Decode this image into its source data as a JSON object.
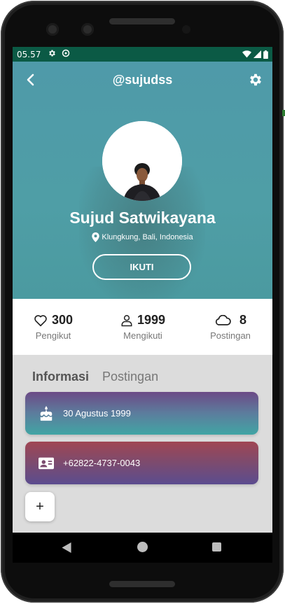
{
  "status_bar": {
    "time": "05.57"
  },
  "header": {
    "username": "@sujudss"
  },
  "profile": {
    "name": "Sujud Satwikayana",
    "location": "Klungkung, Bali, Indonesia",
    "follow_label": "IKUTI"
  },
  "stats": [
    {
      "value": "300",
      "label": "Pengikut",
      "icon": "heart-icon"
    },
    {
      "value": "1999",
      "label": "Mengikuti",
      "icon": "person-icon"
    },
    {
      "value": "8",
      "label": "Postingan",
      "icon": "cloud-icon"
    }
  ],
  "tabs": [
    {
      "label": "Informasi",
      "active": true
    },
    {
      "label": "Postingan",
      "active": false
    }
  ],
  "info": [
    {
      "text": "30 Agustus 1999",
      "icon": "birthday-cake-icon"
    },
    {
      "text": "+62822-4737-0043",
      "icon": "contact-card-icon"
    }
  ],
  "add_button_label": "+",
  "colors": {
    "status_bar": "#0b5a45",
    "hero": "#4f9ea6",
    "card1_top": "#6c4a86",
    "card1_bottom": "#41a5a4",
    "card2_top": "#a04653",
    "card2_bottom": "#5b4c8f"
  }
}
